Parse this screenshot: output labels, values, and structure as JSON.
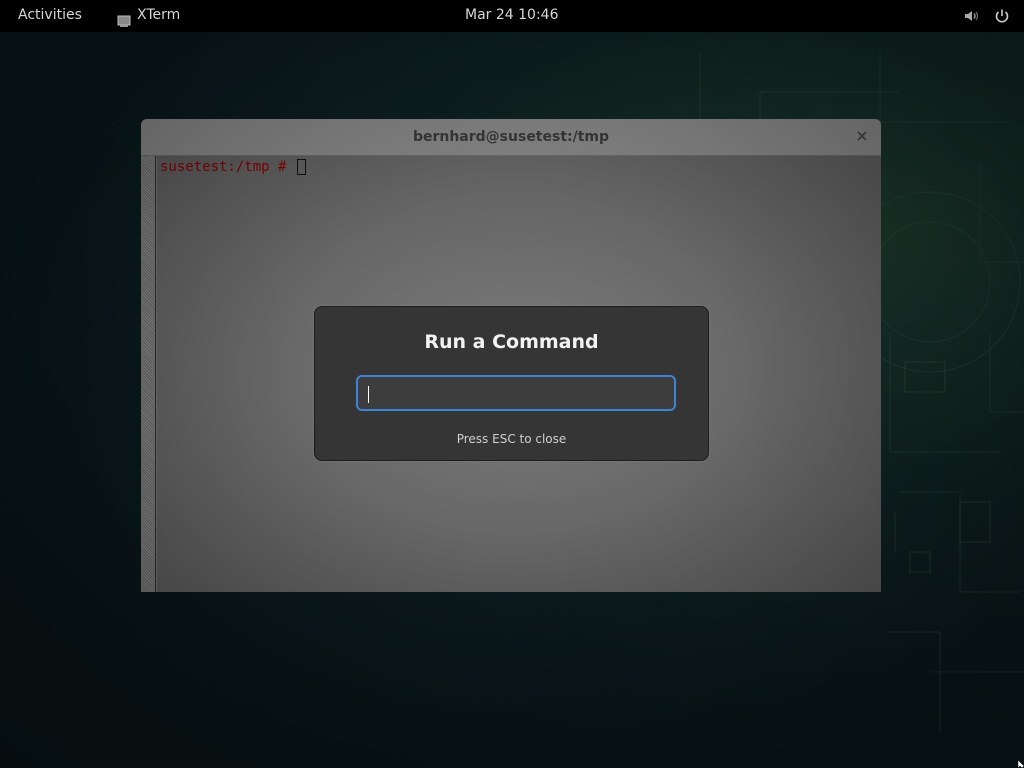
{
  "topbar": {
    "activities_label": "Activities",
    "app_name": "XTerm",
    "clock": "Mar 24  10:46",
    "tray_icons": [
      "volume-icon",
      "power-icon"
    ]
  },
  "xterm": {
    "title": "bernhard@susetest:/tmp",
    "prompt": "susetest:/tmp # ",
    "prompt_color": "#8b0000"
  },
  "run_dialog": {
    "title": "Run a Command",
    "input_value": "",
    "hint": "Press ESC to close",
    "focus_color": "#3d84d6"
  }
}
